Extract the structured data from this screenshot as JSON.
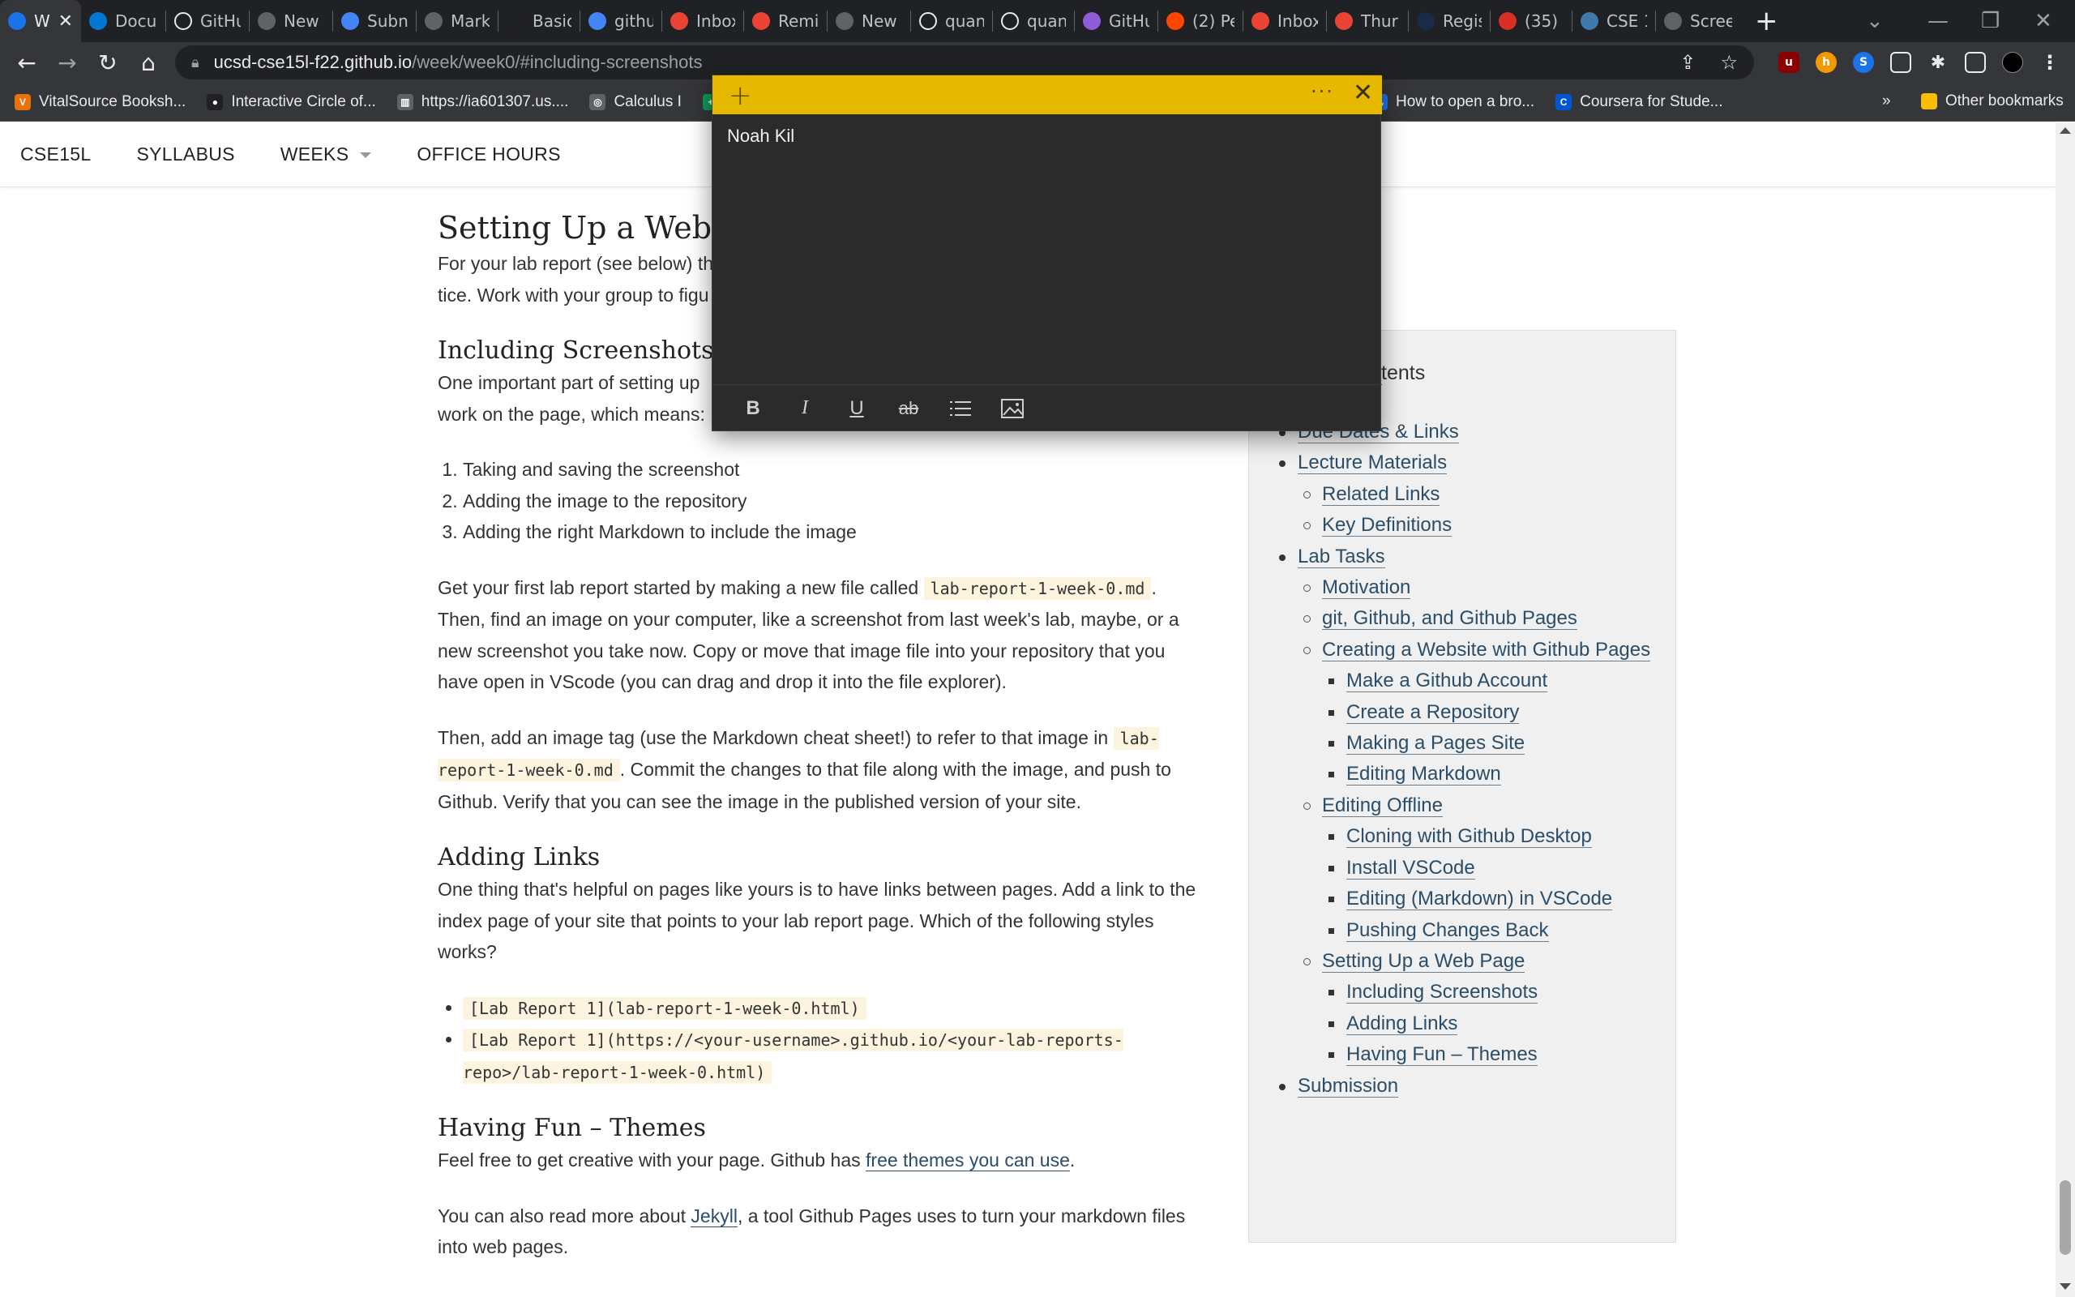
{
  "browser": {
    "tabs": [
      {
        "label": "W",
        "favicon": "chrome",
        "color": "#1a73e8",
        "active": true
      },
      {
        "label": "Docu",
        "favicon": "vscode",
        "color": "#0078d4"
      },
      {
        "label": "GitHu",
        "favicon": "github",
        "color": "#e8eaed"
      },
      {
        "label": "New",
        "favicon": "chrome",
        "color": "#5f6368"
      },
      {
        "label": "Subn",
        "favicon": "chart",
        "color": "#4285f4"
      },
      {
        "label": "Mark",
        "favicon": "markdown",
        "color": "#5f6368"
      },
      {
        "label": "Basic",
        "favicon": "blank",
        "color": "#202124"
      },
      {
        "label": "githu",
        "favicon": "google",
        "color": "#4285f4"
      },
      {
        "label": "Inbox",
        "favicon": "gmail",
        "color": "#ea4335"
      },
      {
        "label": "Remi",
        "favicon": "gmail",
        "color": "#ea4335"
      },
      {
        "label": "New",
        "favicon": "chrome",
        "color": "#5f6368"
      },
      {
        "label": "quan",
        "favicon": "github",
        "color": "#e8eaed"
      },
      {
        "label": "quan",
        "favicon": "github",
        "color": "#e8eaed"
      },
      {
        "label": "GitHu",
        "favicon": "github-desktop",
        "color": "#8e5cd9"
      },
      {
        "label": "(2) Pe",
        "favicon": "reddit",
        "color": "#ff4500"
      },
      {
        "label": "Inbox",
        "favicon": "gmail",
        "color": "#ea4335"
      },
      {
        "label": "Thur",
        "favicon": "gmail",
        "color": "#ea4335"
      },
      {
        "label": "Regis",
        "favicon": "ucsd",
        "color": "#182b49"
      },
      {
        "label": "(35) I",
        "favicon": "badge",
        "color": "#d93025"
      },
      {
        "label": "CSE 1",
        "favicon": "piazza",
        "color": "#3e7aab"
      },
      {
        "label": "Scree",
        "favicon": "chrome",
        "color": "#5f6368"
      }
    ],
    "url_host": "ucsd-cse15l-f22.github.io",
    "url_path": "/week/week0/#including-screenshots",
    "bookmarks": [
      {
        "label": "VitalSource Booksh...",
        "color": "#e8710a",
        "icon": "V"
      },
      {
        "label": "Interactive Circle of...",
        "color": "#202124",
        "icon": "●"
      },
      {
        "label": "https://ia601307.us....",
        "color": "#5f6368",
        "icon": "▥"
      },
      {
        "label": "Calculus I",
        "color": "#5f6368",
        "icon": "◎"
      },
      {
        "label": "",
        "color": "#0f9d58",
        "icon": "+"
      }
    ],
    "bookmarks_right": [
      {
        "label": "How to open a bro...",
        "color": "#1a73e8",
        "icon": "◡"
      },
      {
        "label": "Coursera for Stude...",
        "color": "#0056d2",
        "icon": "C"
      }
    ],
    "other_bookmarks": "Other bookmarks",
    "more_bookmarks": "»"
  },
  "site": {
    "nav": [
      "CSE15L",
      "SYLLABUS",
      "WEEKS",
      "OFFICE HOURS"
    ],
    "heading_setup": "Setting Up a Web Page",
    "p_setup_1": "For your lab report (see below) the",
    "p_setup_2": "tice. Work with your group to figu",
    "heading_screens": "Including Screenshots",
    "p_screens_1": "One important part of setting up",
    "p_screens_2": "work on the page, which means:",
    "steps": [
      "Taking and saving the screenshot",
      "Adding the image to the repository",
      "Adding the right Markdown to include the image"
    ],
    "p_lab_a": "Get your first lab report started by making a new file called ",
    "p_lab_code": "lab-report-1-week-0.md",
    "p_lab_b": ". Then, find an image on your computer, like a screenshot from last week's lab, maybe, or a new screenshot you take now. Copy or move that image file into your repository that you have open in VScode (you can drag and drop it into the file explorer).",
    "p_tag_a": "Then, add an image tag (use the Markdown cheat sheet!) to refer to that image in ",
    "p_tag_code": "lab-report-1-week-0.md",
    "p_tag_b": ". Commit the changes to that file along with the image, and push to Github. Verify that you can see the image in the published version of your site.",
    "heading_links": "Adding Links",
    "p_links": "One thing that's helpful on pages like yours is to have links between pages. Add a link to the index page of your site that points to your lab report page. Which of the following styles works?",
    "link_options": [
      "[Lab Report 1](lab-report-1-week-0.html)",
      "[Lab Report 1](https://<your-username>.github.io/<your-lab-reports-repo>/lab-report-1-week-0.html)"
    ],
    "heading_themes": "Having Fun – Themes",
    "p_themes_a": "Feel free to get creative with your page. Github has ",
    "p_themes_link": "free themes you can use",
    "p_themes_b": ".",
    "p_jekyll_a": "You can also read more about ",
    "p_jekyll_link": "Jekyll",
    "p_jekyll_b": ", a tool Github Pages uses to turn your markdown files into web pages."
  },
  "toc": {
    "title": "tents",
    "items": [
      {
        "label": "Due Dates & Links",
        "level": 1
      },
      {
        "label": "Lecture Materials",
        "level": 1
      },
      {
        "label": "Related Links",
        "level": 2
      },
      {
        "label": "Key Definitions",
        "level": 2
      },
      {
        "label": "Lab Tasks",
        "level": 1
      },
      {
        "label": "Motivation",
        "level": 2
      },
      {
        "label": "git, Github, and Github Pages",
        "level": 2
      },
      {
        "label": "Creating a Website with Github Pages",
        "level": 2
      },
      {
        "label": "Make a Github Account",
        "level": 3
      },
      {
        "label": "Create a Repository",
        "level": 3
      },
      {
        "label": "Making a Pages Site",
        "level": 3
      },
      {
        "label": "Editing Markdown",
        "level": 3
      },
      {
        "label": "Editing Offline",
        "level": 2
      },
      {
        "label": "Cloning with Github Desktop",
        "level": 3
      },
      {
        "label": "Install VSCode",
        "level": 3
      },
      {
        "label": "Editing (Markdown) in VSCode",
        "level": 3
      },
      {
        "label": "Pushing Changes Back",
        "level": 3
      },
      {
        "label": "Setting Up a Web Page",
        "level": 2
      },
      {
        "label": "Including Screenshots",
        "level": 3
      },
      {
        "label": "Adding Links",
        "level": 3
      },
      {
        "label": "Having Fun – Themes",
        "level": 3
      },
      {
        "label": "Submission",
        "level": 1
      }
    ]
  },
  "sticky_note": {
    "text": "Noah Kil",
    "header_color": "#e6b800",
    "tools": [
      "bold",
      "italic",
      "underline",
      "strikethrough",
      "bullets",
      "image"
    ]
  }
}
